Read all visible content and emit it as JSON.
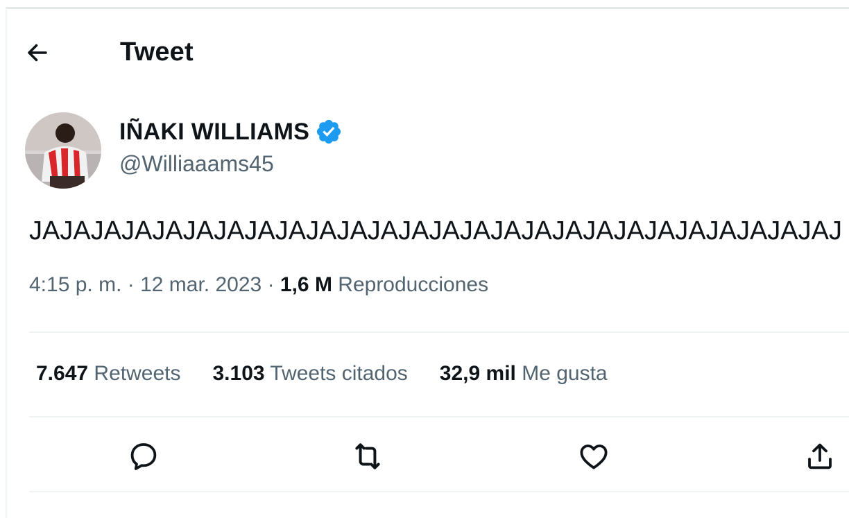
{
  "header": {
    "title": "Tweet",
    "back_icon": "arrow-left-icon"
  },
  "author": {
    "display_name": "IÑAKI WILLIAMS",
    "handle": "@Williaaams45",
    "verified_icon": "verified-badge-icon",
    "verified_color": "#1d9bf0"
  },
  "tweet": {
    "text": "JAJAJAJAJAJAJAJAJAJAJAJAJAJAJAJAJAJAJAJAJAJAJAJAJAJAJ"
  },
  "meta": {
    "time": "4:15 p. m.",
    "separator": "·",
    "date": "12 mar. 2023",
    "views_count": "1,6 M",
    "views_label": "Reproducciones"
  },
  "stats": {
    "retweets_count": "7.647",
    "retweets_label": "Retweets",
    "quotes_count": "3.103",
    "quotes_label": "Tweets citados",
    "likes_count": "32,9 mil",
    "likes_label": "Me gusta"
  },
  "actions": {
    "icons": [
      "reply-icon",
      "retweet-icon",
      "like-icon",
      "share-icon"
    ]
  },
  "colors": {
    "text_primary": "#0f1419",
    "text_secondary": "#536471",
    "divider": "#eff3f4",
    "accent": "#1d9bf0"
  }
}
